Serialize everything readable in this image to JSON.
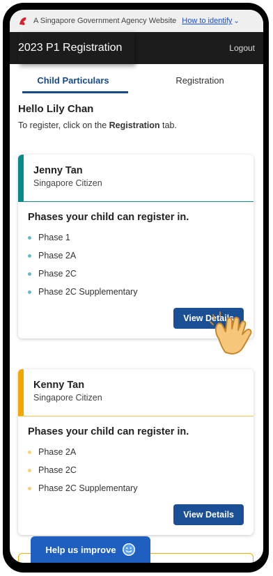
{
  "gov_bar": {
    "text": "A Singapore Government Agency Website",
    "link": "How to identify"
  },
  "app": {
    "title": "2023 P1 Registration",
    "logout": "Logout"
  },
  "tabs": [
    {
      "label": "Child Particulars",
      "active": true
    },
    {
      "label": "Registration",
      "active": false
    }
  ],
  "greeting": {
    "hello": "Hello Lily Chan",
    "instr_before": "To register, click on the ",
    "instr_bold": "Registration",
    "instr_after": " tab."
  },
  "cards": [
    {
      "name": "Jenny Tan",
      "citizenship": "Singapore Citizen",
      "accent": "#0a8a8a",
      "phases_title": "Phases your child can register in.",
      "phases": [
        "Phase 1",
        "Phase 2A",
        "Phase 2C",
        "Phase 2C Supplementary"
      ],
      "button": "View Details"
    },
    {
      "name": "Kenny Tan",
      "citizenship": "Singapore Citizen",
      "accent": "#f0a800",
      "phases_title": "Phases your child can register in.",
      "phases": [
        "Phase 2A",
        "Phase 2C",
        "Phase 2C Supplementary"
      ],
      "button": "View Details"
    }
  ],
  "help": {
    "label": "Help us improve"
  },
  "colors": {
    "primary": "#1a4f96",
    "teal": "#0a8a8a",
    "amber": "#f0a800",
    "dark_bar": "#1c1c1c"
  }
}
